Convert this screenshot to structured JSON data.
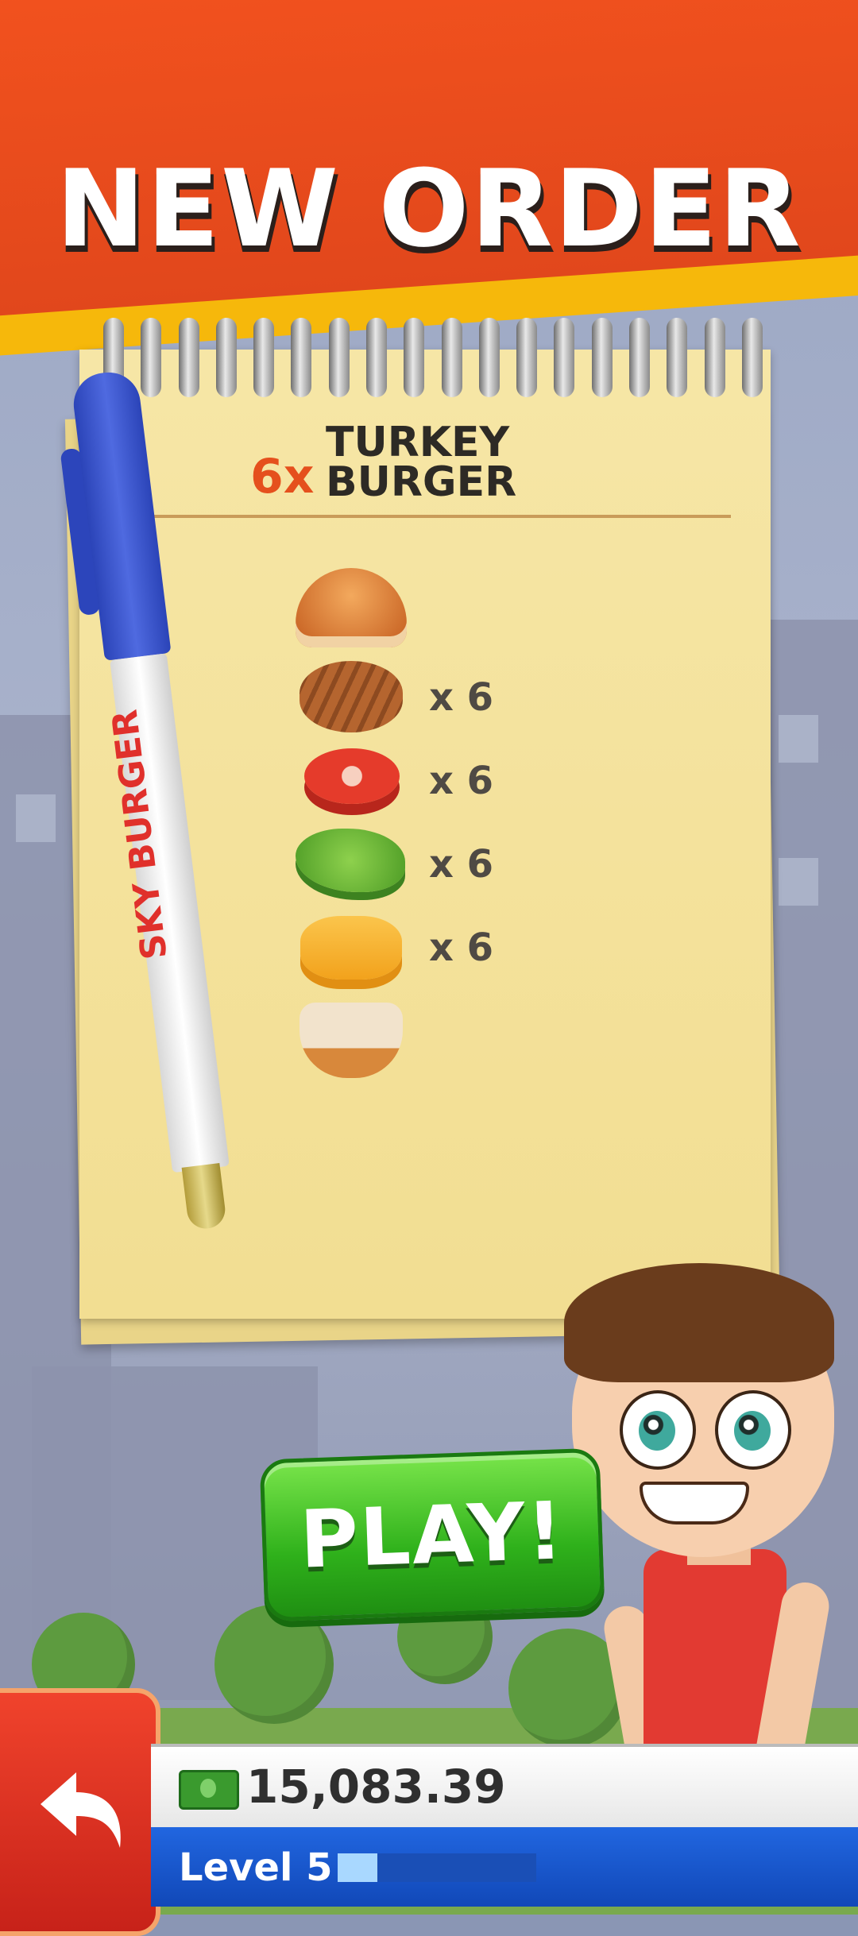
{
  "header": {
    "title": "NEW ORDER"
  },
  "order": {
    "quantity": "6x",
    "name_line1": "TURKEY",
    "name_line2": "BURGER"
  },
  "ingredients": [
    {
      "name": "top bun",
      "count": ""
    },
    {
      "name": "patty",
      "count": "x 6"
    },
    {
      "name": "tomato",
      "count": "x 6"
    },
    {
      "name": "lettuce",
      "count": "x 6"
    },
    {
      "name": "cheese",
      "count": "x 6"
    },
    {
      "name": "bottom bun",
      "count": ""
    }
  ],
  "pen": {
    "brand": "SKY BURGER"
  },
  "play_button": {
    "label": "PLAY!"
  },
  "status": {
    "cash": "15,083.39",
    "level": "Level 5",
    "xp_progress": 0.2
  },
  "icons": {
    "back": "back-arrow-icon",
    "cash": "cash-icon"
  },
  "colors": {
    "header_red": "#f4531e",
    "header_yellow": "#f6b80b",
    "play_green": "#2fb11b",
    "level_blue": "#1a5bd0"
  }
}
